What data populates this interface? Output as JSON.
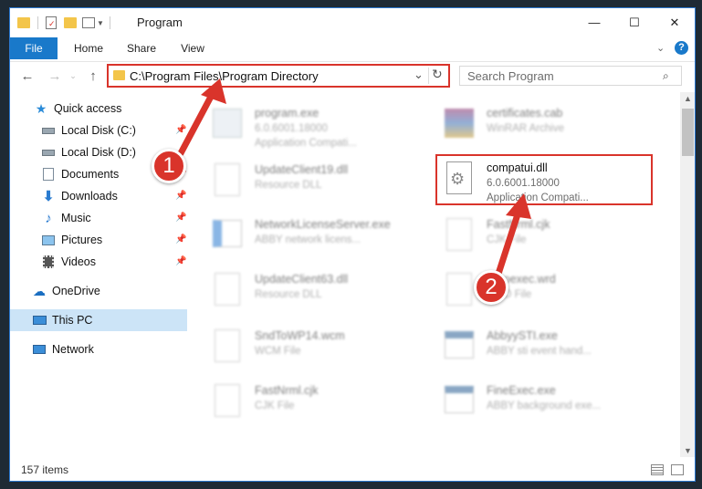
{
  "window": {
    "title": "Program",
    "minimize_label": "—",
    "maximize_label": "☐",
    "close_label": "✕"
  },
  "ribbon": {
    "tabs": [
      "File",
      "Home",
      "Share",
      "View"
    ]
  },
  "address": {
    "path": "C:\\Program Files\\Program Directory",
    "search_placeholder": "Search Program"
  },
  "navigation": {
    "items": [
      {
        "label": "Quick access",
        "icon": "star-icon",
        "pinned": false
      },
      {
        "label": "Local Disk (C:)",
        "icon": "drive-icon",
        "pinned": true
      },
      {
        "label": "Local Disk (D:)",
        "icon": "drive-icon",
        "pinned": false
      },
      {
        "label": "Documents",
        "icon": "documents-icon",
        "pinned": true
      },
      {
        "label": "Downloads",
        "icon": "download-icon",
        "pinned": true
      },
      {
        "label": "Music",
        "icon": "music-icon",
        "pinned": true
      },
      {
        "label": "Pictures",
        "icon": "pictures-icon",
        "pinned": true
      },
      {
        "label": "Videos",
        "icon": "videos-icon",
        "pinned": true
      },
      {
        "label": "OneDrive",
        "icon": "cloud-icon",
        "pinned": false
      },
      {
        "label": "This PC",
        "icon": "computer-icon",
        "pinned": false,
        "selected": true
      },
      {
        "label": "Network",
        "icon": "network-icon",
        "pinned": false
      }
    ]
  },
  "files": [
    {
      "name": "program.exe",
      "line2": "6.0.6001.18000",
      "line3": "Application Compati...",
      "icon": "exe-icon"
    },
    {
      "name": "certificates.cab",
      "line2": "WinRAR Archive",
      "line3": "",
      "icon": "archive-icon"
    },
    {
      "name": "UpdateClient19.dll",
      "line2": "Resource DLL",
      "line3": "",
      "icon": "dll-icon"
    },
    {
      "name": "compatui.dll",
      "line2": "6.0.6001.18000",
      "line3": "Application Compati...",
      "icon": "dll-gear-icon",
      "highlighted": true
    },
    {
      "name": "NetworkLicenseServer.exe",
      "line2": "ABBY network licens...",
      "line3": "",
      "icon": "exe-icon"
    },
    {
      "name": "FastNrml.cjk",
      "line2": "CJK File",
      "line3": "",
      "icon": "file-icon"
    },
    {
      "name": "UpdateClient63.dll",
      "line2": "Resource DLL",
      "line3": "",
      "icon": "dll-icon"
    },
    {
      "name": "Autoexec.wrd",
      "line2": "WRD File",
      "line3": "",
      "icon": "file-icon"
    },
    {
      "name": "SndToWP14.wcm",
      "line2": "WCM File",
      "line3": "",
      "icon": "file-icon"
    },
    {
      "name": "AbbyySTI.exe",
      "line2": "ABBY sti event hand...",
      "line3": "",
      "icon": "exe-icon"
    },
    {
      "name": "FastNrml.cjk",
      "line2": "CJK File",
      "line3": "",
      "icon": "file-icon"
    },
    {
      "name": "FineExec.exe",
      "line2": "ABBY background exe...",
      "line3": "",
      "icon": "exe-icon"
    }
  ],
  "status": {
    "item_count": "157 items"
  },
  "annotations": [
    {
      "number": "1"
    },
    {
      "number": "2"
    }
  ],
  "colors": {
    "accent": "#1979ca",
    "annotation_red": "#d9342b",
    "selected_bg": "#cce4f7"
  }
}
